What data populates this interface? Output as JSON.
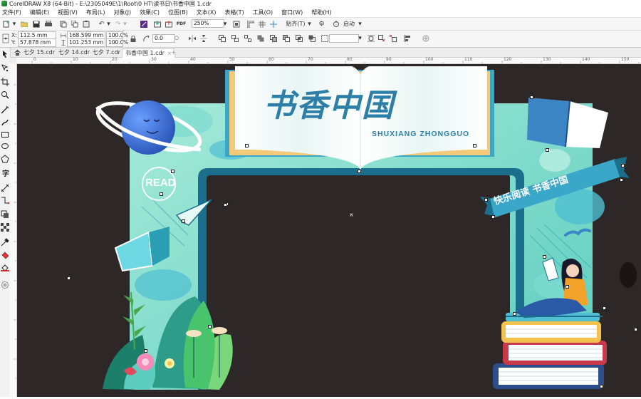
{
  "window": {
    "title": "CorelDRAW X8 (64-Bit) - E:\\2305049E\\1\\Root\\0 HT\\读书日\\书香中国 1.cdr"
  },
  "menu": [
    {
      "label": "文件(F)"
    },
    {
      "label": "编辑(E)"
    },
    {
      "label": "视图(V)"
    },
    {
      "label": "布局(L)"
    },
    {
      "label": "对象(J)"
    },
    {
      "label": "效果(C)"
    },
    {
      "label": "位图(B)"
    },
    {
      "label": "文本(X)"
    },
    {
      "label": "表格(T)"
    },
    {
      "label": "工具(O)"
    },
    {
      "label": "窗口(W)"
    },
    {
      "label": "帮助(H)"
    }
  ],
  "toolbar": {
    "zoom_value": "250%",
    "snap_label": "贴齐(T)",
    "launch_label": "启动"
  },
  "properties": {
    "x_label": "X:",
    "x_value": "112.5 mm",
    "y_label": "Y:",
    "y_value": "57.878 mm",
    "width_value": "168.599 mm",
    "height_value": "101.253 mm",
    "scale_x": "100.0",
    "scale_y": "100.0",
    "percent": "%",
    "rotation": "0.0"
  },
  "tabs": [
    {
      "label": "七夕 15.cdr",
      "active": false
    },
    {
      "label": "七夕 14.cdr",
      "active": false
    },
    {
      "label": "七夕 7.cdr",
      "active": false
    },
    {
      "label": "书香中国 1.cdr",
      "active": true
    }
  ],
  "ruler": {
    "ticks": [
      "0",
      "10",
      "20",
      "30",
      "40",
      "50",
      "60",
      "70",
      "80",
      "90",
      "100",
      "110",
      "120",
      "130",
      "140",
      "150",
      "160",
      "170",
      "180",
      "190",
      "200",
      "210"
    ]
  },
  "artwork": {
    "title": "书香中国",
    "subtitle": "SHUXIANG ZHONGGUO",
    "badge": "READ",
    "ribbon": "快乐阅读 书香中国"
  },
  "colors": {
    "canvas_bg": "#2d2728",
    "arch_mint": "#8fe3d2",
    "arch_teal": "#29a6c2",
    "arch_dark": "#1b6f8c",
    "title_blue": "#2d7fa8",
    "planet_blue": "#3c74d6",
    "book_red": "#c83a4a",
    "book_navy": "#2d4e8c",
    "book_yellow": "#f2c14e",
    "shirt_orange": "#f4a32a"
  }
}
